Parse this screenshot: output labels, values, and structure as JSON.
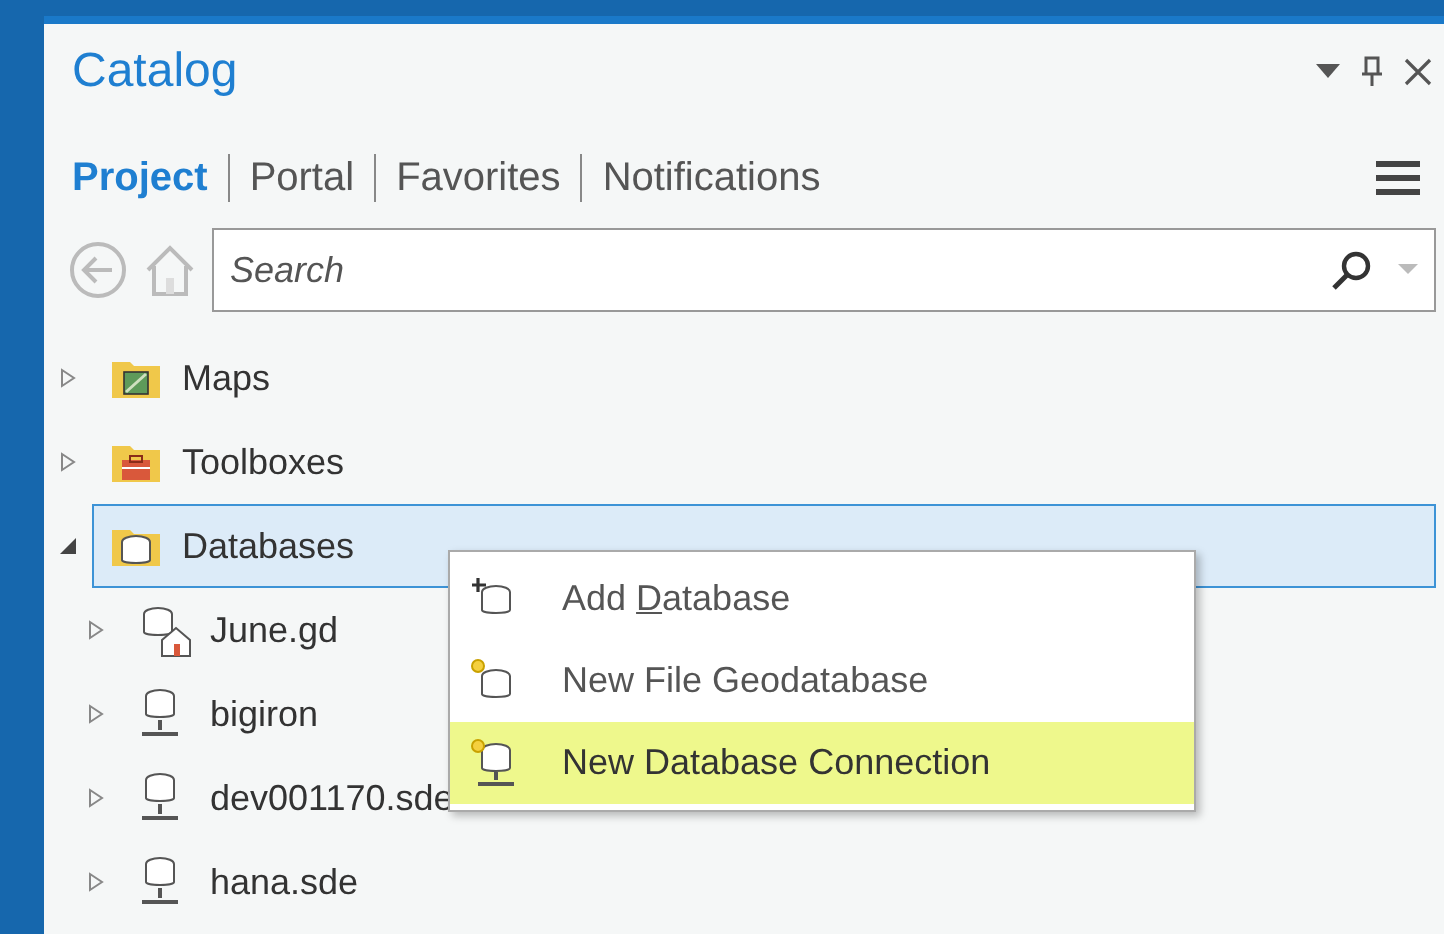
{
  "panel": {
    "title": "Catalog"
  },
  "tabs": [
    {
      "label": "Project",
      "selected": true
    },
    {
      "label": "Portal",
      "selected": false
    },
    {
      "label": "Favorites",
      "selected": false
    },
    {
      "label": "Notifications",
      "selected": false
    }
  ],
  "search": {
    "placeholder": "Search"
  },
  "tree": [
    {
      "label": "Maps",
      "kind": "maps",
      "expanded": false,
      "selected": false
    },
    {
      "label": "Toolboxes",
      "kind": "toolboxes",
      "expanded": false,
      "selected": false
    },
    {
      "label": "Databases",
      "kind": "databases",
      "expanded": true,
      "selected": true,
      "children": [
        {
          "label": "June.gd",
          "kind": "home",
          "expanded": false,
          "selected": false
        },
        {
          "label": "bigiron",
          "kind": "server",
          "expanded": false,
          "selected": false
        },
        {
          "label": "dev001170.sde",
          "kind": "server",
          "expanded": false,
          "selected": false
        },
        {
          "label": "hana.sde",
          "kind": "server",
          "expanded": false,
          "selected": false
        }
      ]
    }
  ],
  "context_menu": [
    {
      "label": "Add ",
      "access_key": "D",
      "label_rest": "atabase",
      "kind": "add",
      "highlighted": false
    },
    {
      "label": "New File Geodatabase",
      "kind": "new-file",
      "highlighted": false
    },
    {
      "label": "New Database Connection",
      "kind": "new-connection",
      "highlighted": true
    }
  ]
}
